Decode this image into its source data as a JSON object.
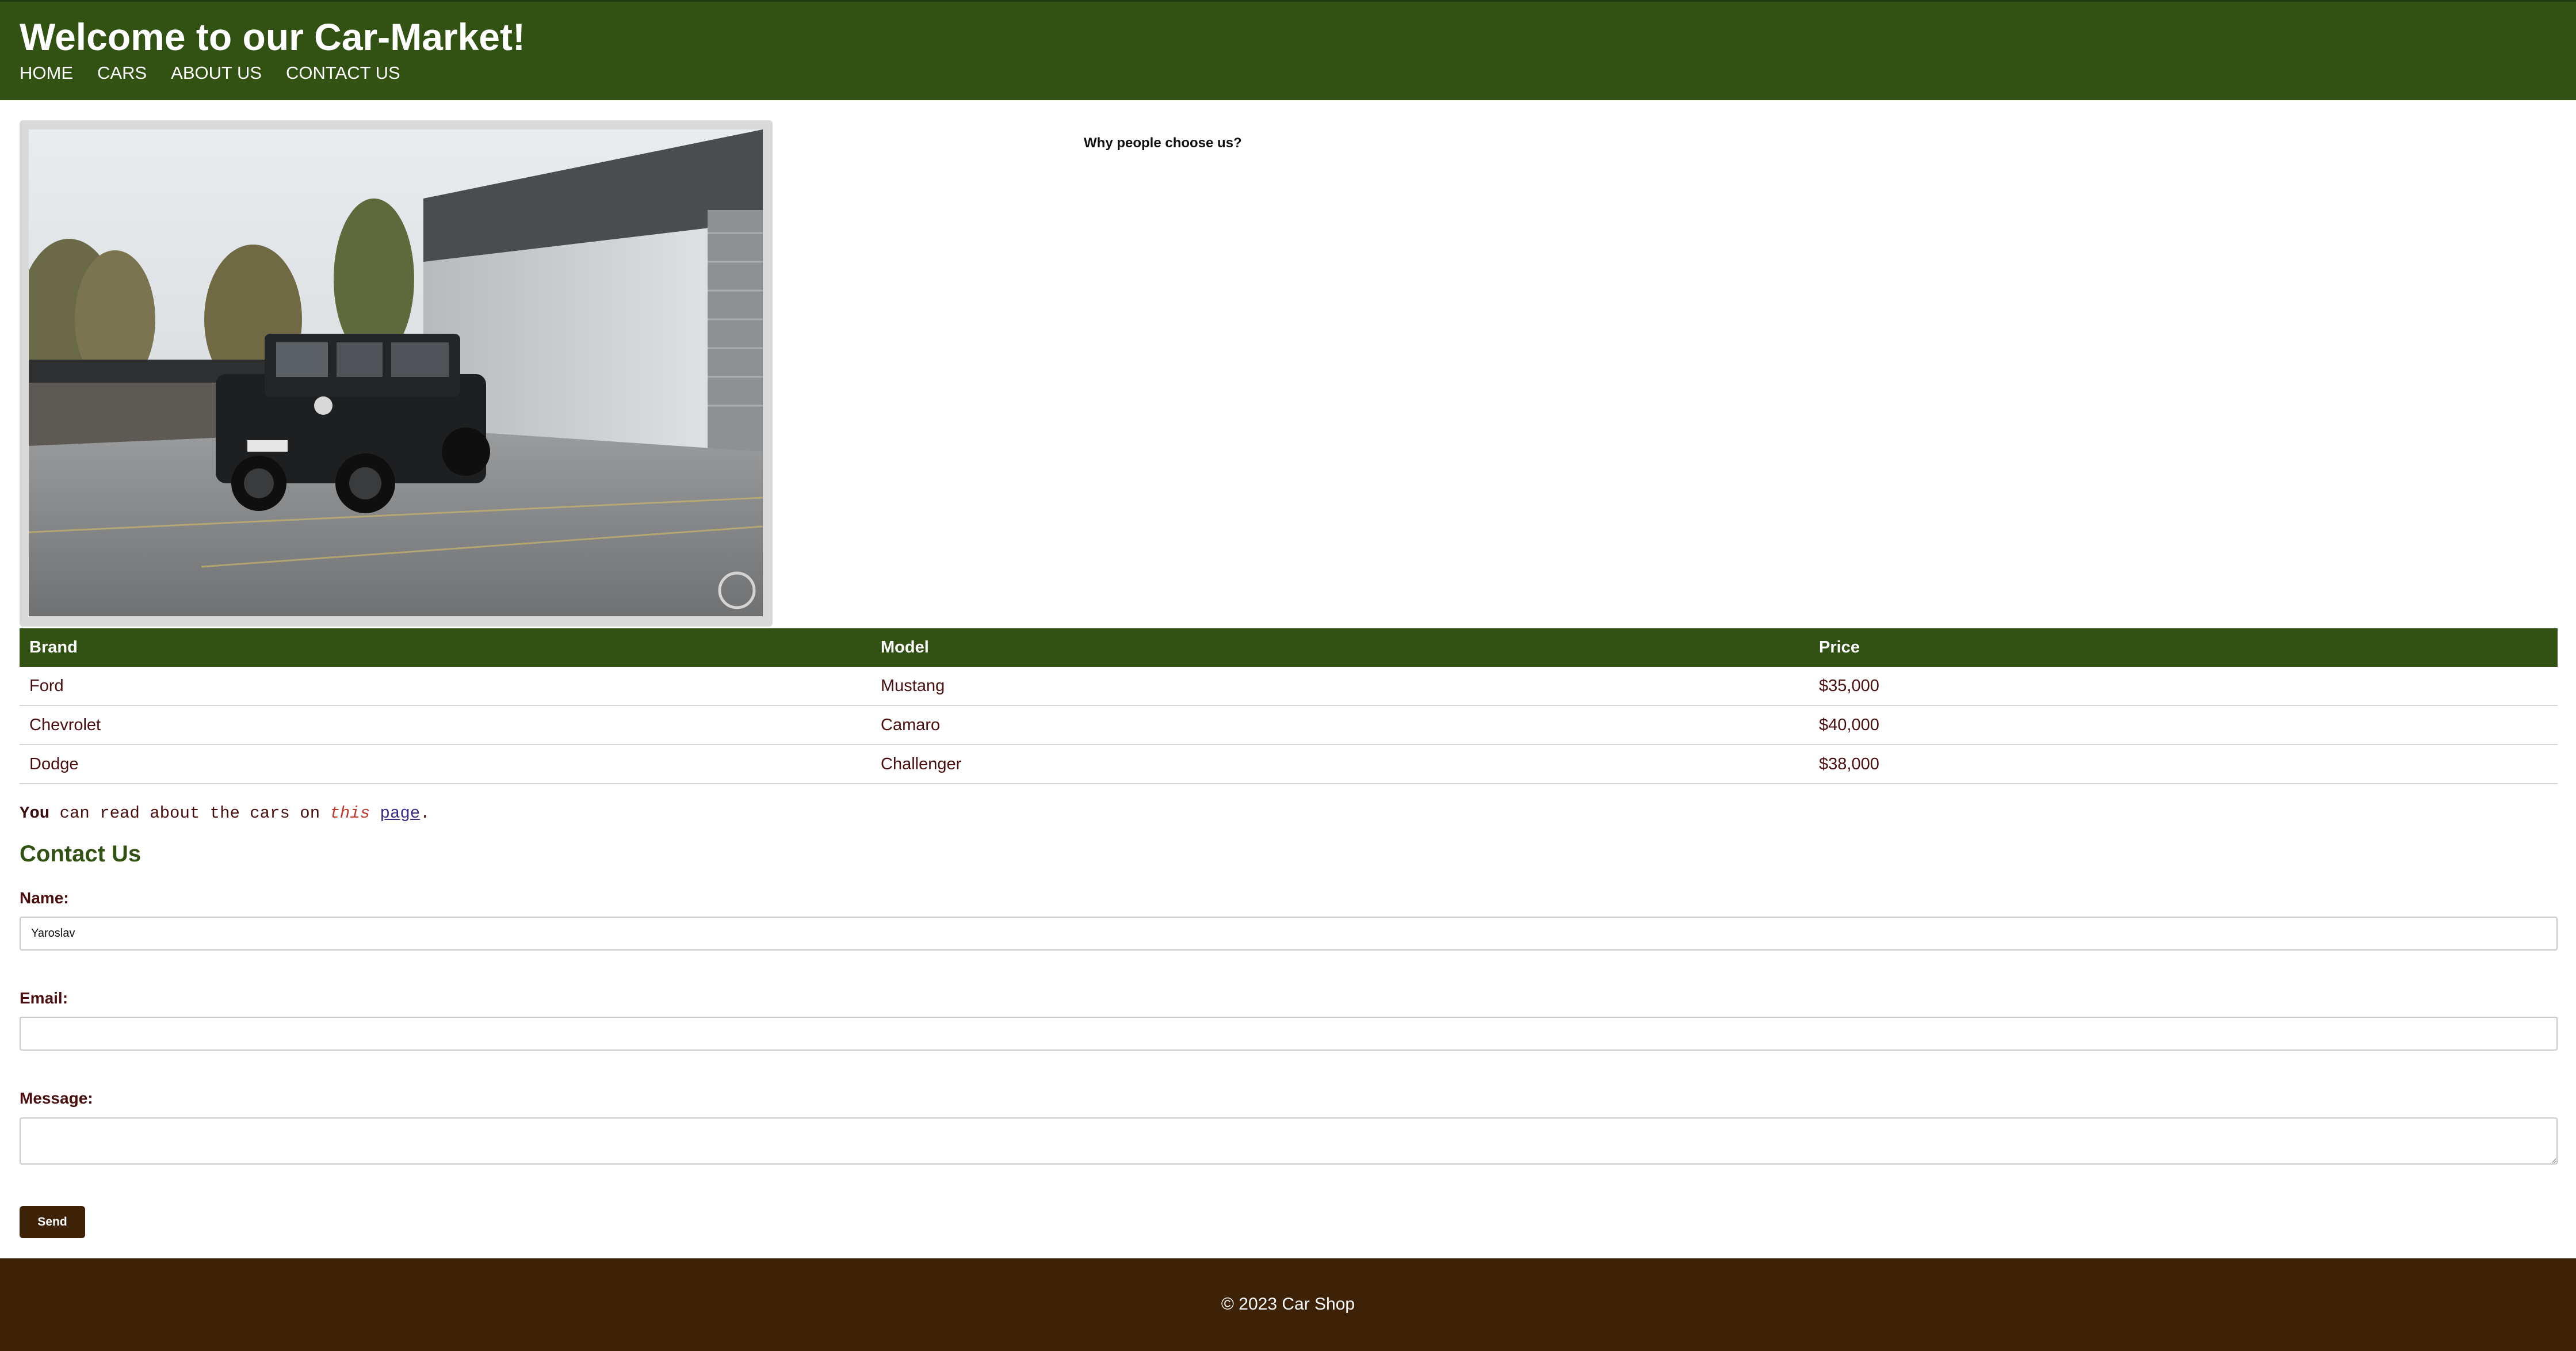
{
  "header": {
    "title": "Welcome to our Car-Market!",
    "nav": [
      "HOME",
      "CARS",
      "ABOUT US",
      "CONTACT US"
    ]
  },
  "hero": {
    "why_heading": "Why people choose us?"
  },
  "table": {
    "headers": [
      "Brand",
      "Model",
      "Price"
    ],
    "rows": [
      [
        "Ford",
        "Mustang",
        "$35,000"
      ],
      [
        "Chevrolet",
        "Camaro",
        "$40,000"
      ],
      [
        "Dodge",
        "Challenger",
        "$38,000"
      ]
    ]
  },
  "info": {
    "part1": "You",
    "part2": " can read about the cars on ",
    "part3": "this",
    "part4": " ",
    "link": "page",
    "part5": "."
  },
  "contact": {
    "title": "Contact Us",
    "name_label": "Name:",
    "name_value": "Yaroslav",
    "email_label": "Email:",
    "email_value": "",
    "message_label": "Message:",
    "message_value": "",
    "send_label": "Send"
  },
  "footer": {
    "copyright": "© 2023 Car Shop"
  },
  "colors": {
    "header_green": "#325214",
    "footer_brown": "#3d2208",
    "text_maroon": "#4a0e0e"
  }
}
